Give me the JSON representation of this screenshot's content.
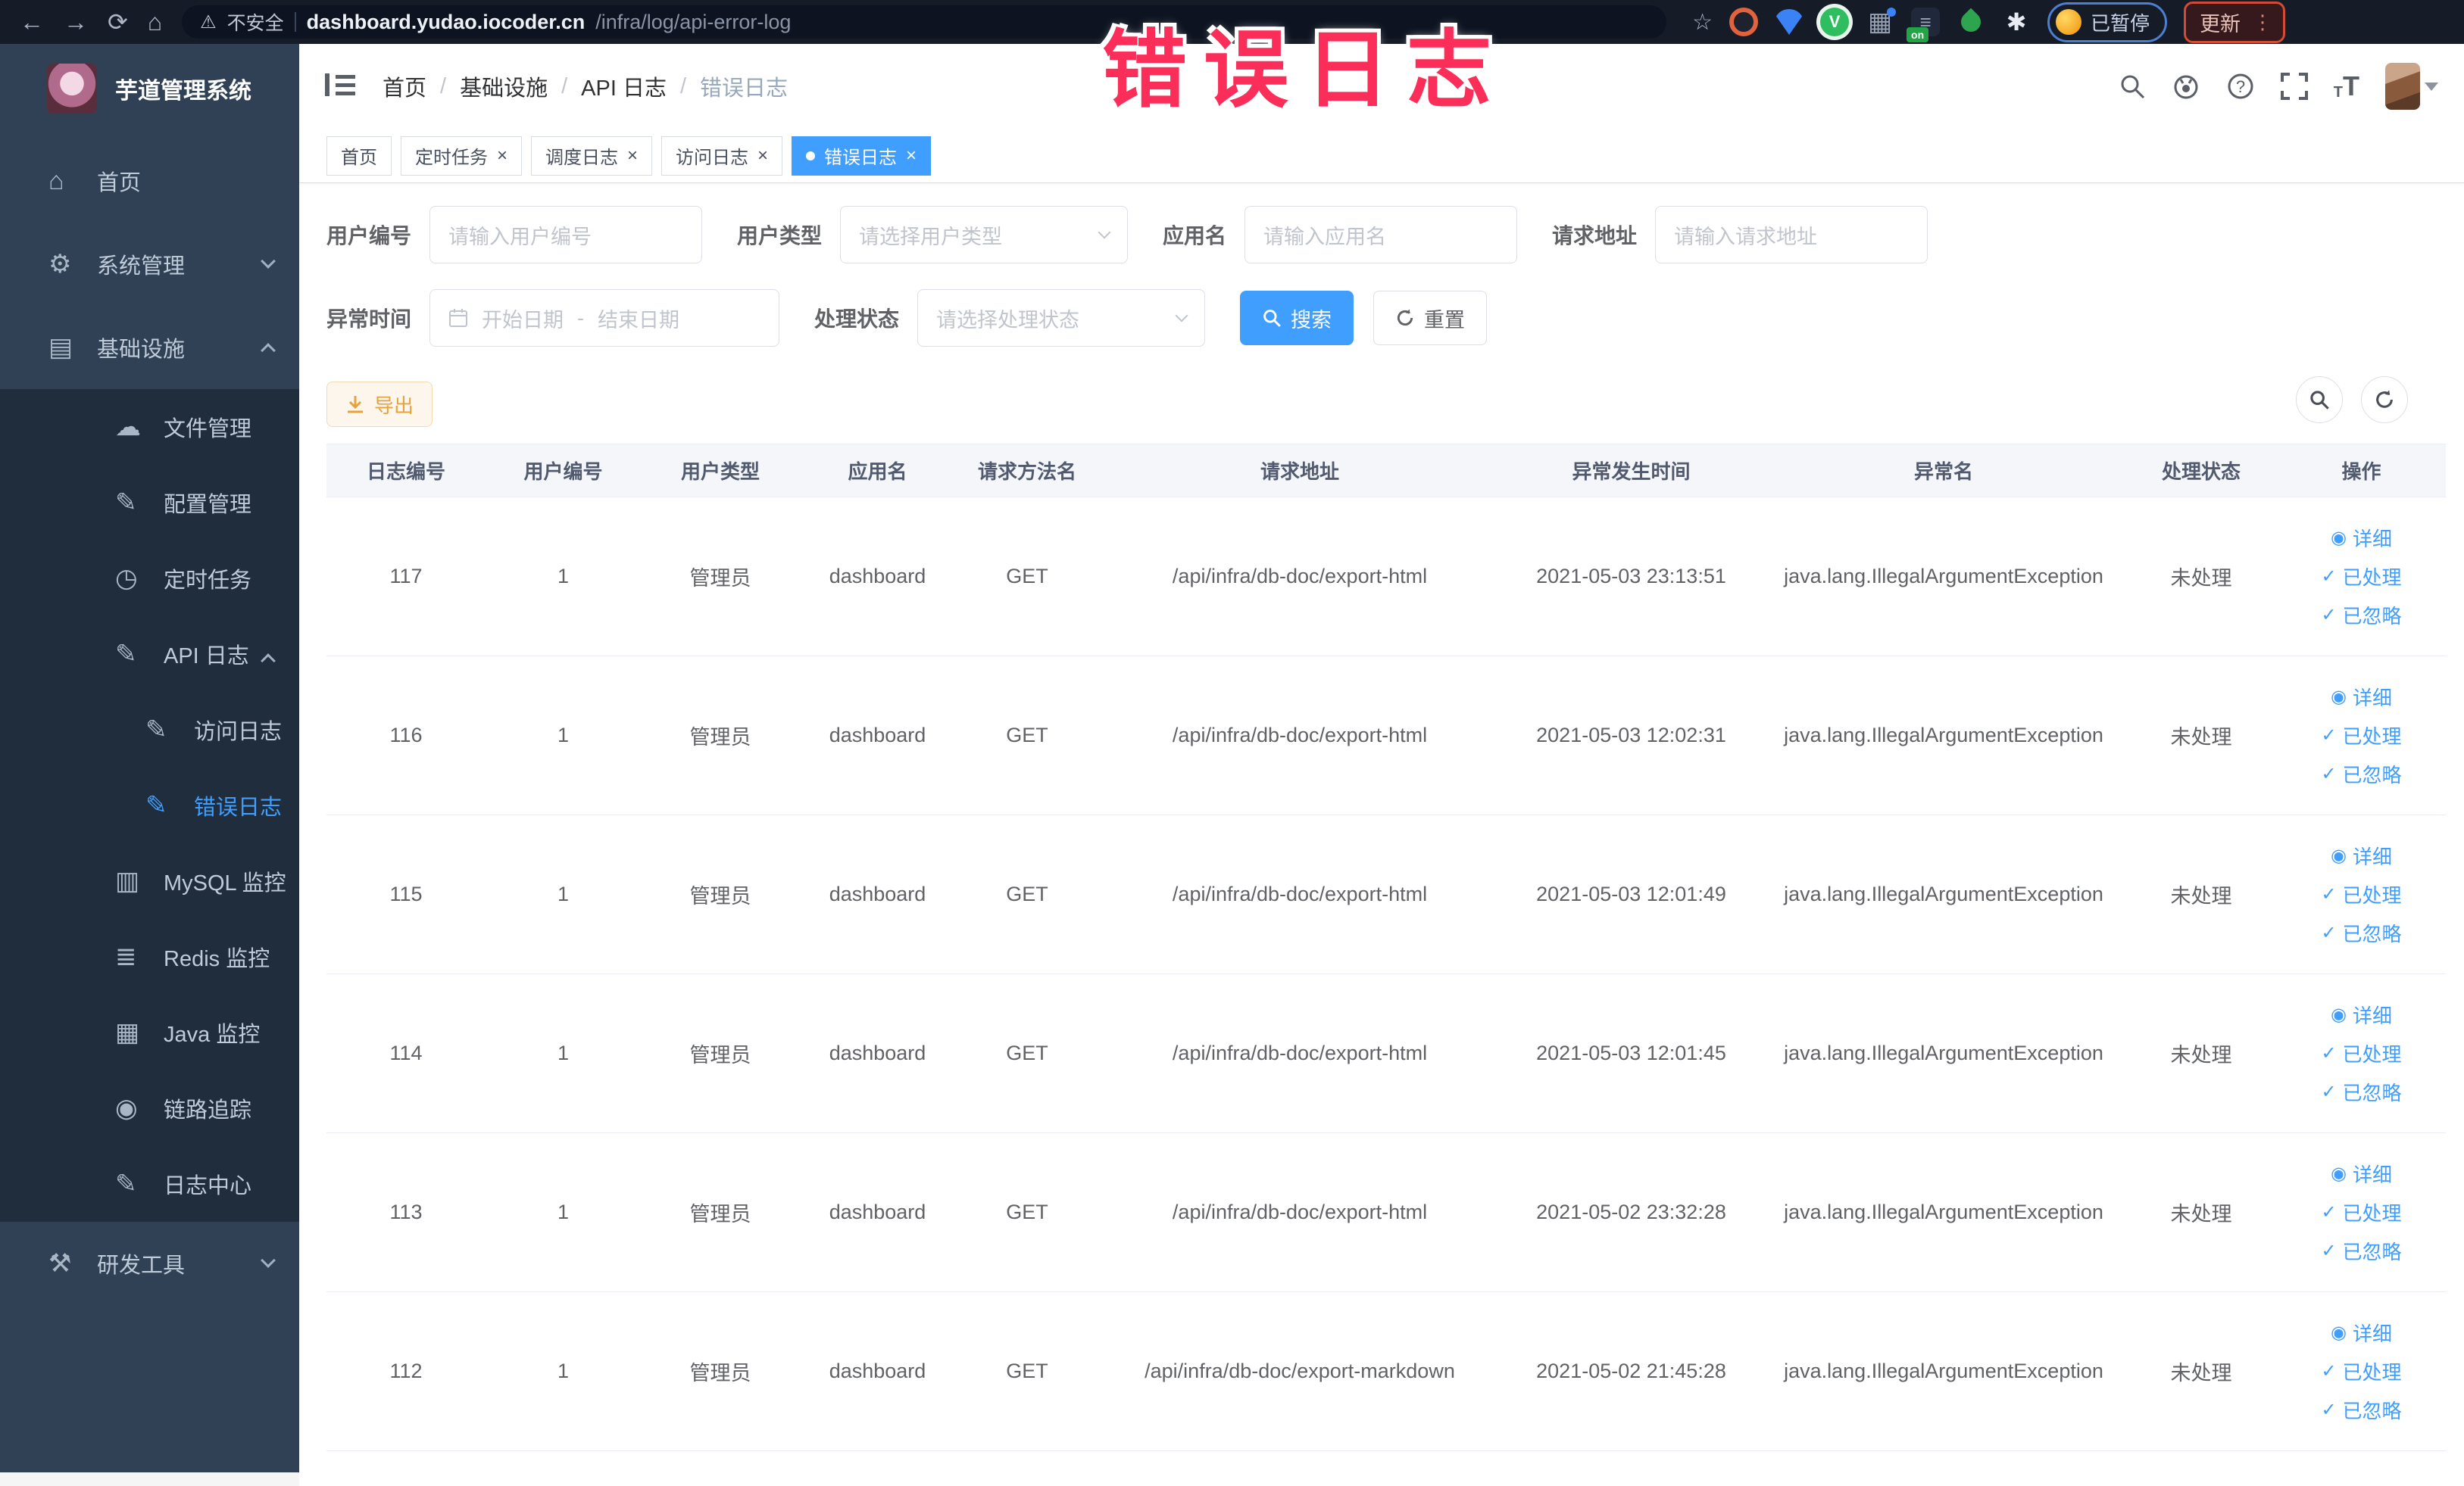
{
  "browser": {
    "security_label": "不安全",
    "url_domain": "dashboard.yudao.iocoder.cn",
    "url_path": "/infra/log/api-error-log",
    "paused_label": "已暂停",
    "update_label": "更新",
    "on_badge": "on"
  },
  "annotation": {
    "text": "错误日志",
    "color": "#fb2e59"
  },
  "sidebar": {
    "title": "芋道管理系统",
    "menu": [
      {
        "name": "home",
        "label": "首页",
        "icon": "home-icon",
        "level": 1,
        "bg": "normal"
      },
      {
        "name": "system-management",
        "label": "系统管理",
        "icon": "gear-icon",
        "level": 1,
        "bg": "normal",
        "chevron": "down"
      },
      {
        "name": "infrastructure",
        "label": "基础设施",
        "icon": "infrastructure-icon",
        "level": 1,
        "bg": "normal",
        "chevron": "up"
      },
      {
        "name": "file-management",
        "label": "文件管理",
        "icon": "file-icon",
        "level": 2,
        "bg": "dark"
      },
      {
        "name": "config-management",
        "label": "配置管理",
        "icon": "config-icon",
        "level": 2,
        "bg": "dark"
      },
      {
        "name": "scheduled-tasks",
        "label": "定时任务",
        "icon": "timer-icon",
        "level": 2,
        "bg": "dark"
      },
      {
        "name": "api-log",
        "label": "API 日志",
        "icon": "api-log-icon",
        "level": 2,
        "bg": "dark",
        "chevron": "up"
      },
      {
        "name": "access-log",
        "label": "访问日志",
        "icon": "access-log-icon",
        "level": 3,
        "bg": "dark"
      },
      {
        "name": "error-log",
        "label": "错误日志",
        "icon": "error-log-icon",
        "level": 3,
        "bg": "dark",
        "active": true
      },
      {
        "name": "mysql-monitor",
        "label": "MySQL 监控",
        "icon": "mysql-monitor-icon",
        "level": 2,
        "bg": "dark"
      },
      {
        "name": "redis-monitor",
        "label": "Redis 监控",
        "icon": "redis-monitor-icon",
        "level": 2,
        "bg": "dark"
      },
      {
        "name": "java-monitor",
        "label": "Java 监控",
        "icon": "java-monitor-icon",
        "level": 2,
        "bg": "dark"
      },
      {
        "name": "trace",
        "label": "链路追踪",
        "icon": "trace-icon",
        "level": 2,
        "bg": "dark"
      },
      {
        "name": "log-center",
        "label": "日志中心",
        "icon": "log-center-icon",
        "level": 2,
        "bg": "dark"
      },
      {
        "name": "dev-tools",
        "label": "研发工具",
        "icon": "dev-tools-icon",
        "level": 1,
        "bg": "normal",
        "chevron": "down"
      }
    ]
  },
  "icons": {
    "home-icon": "⌂",
    "gear-icon": "⚙",
    "infrastructure-icon": "▤",
    "file-icon": "☁",
    "config-icon": "✎",
    "timer-icon": "◷",
    "api-log-icon": "✎",
    "access-log-icon": "✎",
    "error-log-icon": "✎",
    "mysql-monitor-icon": "▥",
    "redis-monitor-icon": "≣",
    "java-monitor-icon": "▦",
    "trace-icon": "◉",
    "log-center-icon": "✎",
    "dev-tools-icon": "⚒",
    "eye-icon": "◉",
    "check-icon": "✓"
  },
  "header": {
    "breadcrumb": [
      "首页",
      "基础设施",
      "API 日志",
      "错误日志"
    ]
  },
  "tabs": [
    {
      "label": "首页",
      "closable": false,
      "active": false
    },
    {
      "label": "定时任务",
      "closable": true,
      "active": false
    },
    {
      "label": "调度日志",
      "closable": true,
      "active": false
    },
    {
      "label": "访问日志",
      "closable": true,
      "active": false
    },
    {
      "label": "错误日志",
      "closable": true,
      "active": true
    }
  ],
  "filters": {
    "user_id": {
      "label": "用户编号",
      "placeholder": "请输入用户编号"
    },
    "user_type": {
      "label": "用户类型",
      "placeholder": "请选择用户类型"
    },
    "app_name": {
      "label": "应用名",
      "placeholder": "请输入应用名"
    },
    "request_url": {
      "label": "请求地址",
      "placeholder": "请输入请求地址"
    },
    "error_time": {
      "label": "异常时间",
      "start_placeholder": "开始日期",
      "separator": "-",
      "end_placeholder": "结束日期"
    },
    "status": {
      "label": "处理状态",
      "placeholder": "请选择处理状态"
    },
    "search_label": "搜索",
    "reset_label": "重置"
  },
  "toolbar": {
    "export_label": "导出"
  },
  "table": {
    "columns": [
      "日志编号",
      "用户编号",
      "用户类型",
      "应用名",
      "请求方法名",
      "请求地址",
      "异常发生时间",
      "异常名",
      "处理状态",
      "操作"
    ],
    "rows": [
      {
        "id": "117",
        "user_id": "1",
        "user_type": "管理员",
        "app": "dashboard",
        "method": "GET",
        "url": "/api/infra/db-doc/export-html",
        "time": "2021-05-03 23:13:51",
        "exception": "java.lang.IllegalArgumentException",
        "status": "未处理"
      },
      {
        "id": "116",
        "user_id": "1",
        "user_type": "管理员",
        "app": "dashboard",
        "method": "GET",
        "url": "/api/infra/db-doc/export-html",
        "time": "2021-05-03 12:02:31",
        "exception": "java.lang.IllegalArgumentException",
        "status": "未处理"
      },
      {
        "id": "115",
        "user_id": "1",
        "user_type": "管理员",
        "app": "dashboard",
        "method": "GET",
        "url": "/api/infra/db-doc/export-html",
        "time": "2021-05-03 12:01:49",
        "exception": "java.lang.IllegalArgumentException",
        "status": "未处理"
      },
      {
        "id": "114",
        "user_id": "1",
        "user_type": "管理员",
        "app": "dashboard",
        "method": "GET",
        "url": "/api/infra/db-doc/export-html",
        "time": "2021-05-03 12:01:45",
        "exception": "java.lang.IllegalArgumentException",
        "status": "未处理"
      },
      {
        "id": "113",
        "user_id": "1",
        "user_type": "管理员",
        "app": "dashboard",
        "method": "GET",
        "url": "/api/infra/db-doc/export-html",
        "time": "2021-05-02 23:32:28",
        "exception": "java.lang.IllegalArgumentException",
        "status": "未处理"
      },
      {
        "id": "112",
        "user_id": "1",
        "user_type": "管理员",
        "app": "dashboard",
        "method": "GET",
        "url": "/api/infra/db-doc/export-markdown",
        "time": "2021-05-02 21:45:28",
        "exception": "java.lang.IllegalArgumentException",
        "status": "未处理"
      }
    ],
    "row_actions": [
      {
        "label": "详细",
        "icon": "eye-icon"
      },
      {
        "label": "已处理",
        "icon": "check-icon"
      },
      {
        "label": "已忽略",
        "icon": "check-icon"
      }
    ]
  },
  "colors": {
    "accent": "#409eff",
    "warning": "#e6a23c",
    "annotation": "#fb2e59",
    "sidebar_bg": "#304156",
    "submenu_bg": "#1f2d3d",
    "browser_bar_bg": "#151b27"
  }
}
